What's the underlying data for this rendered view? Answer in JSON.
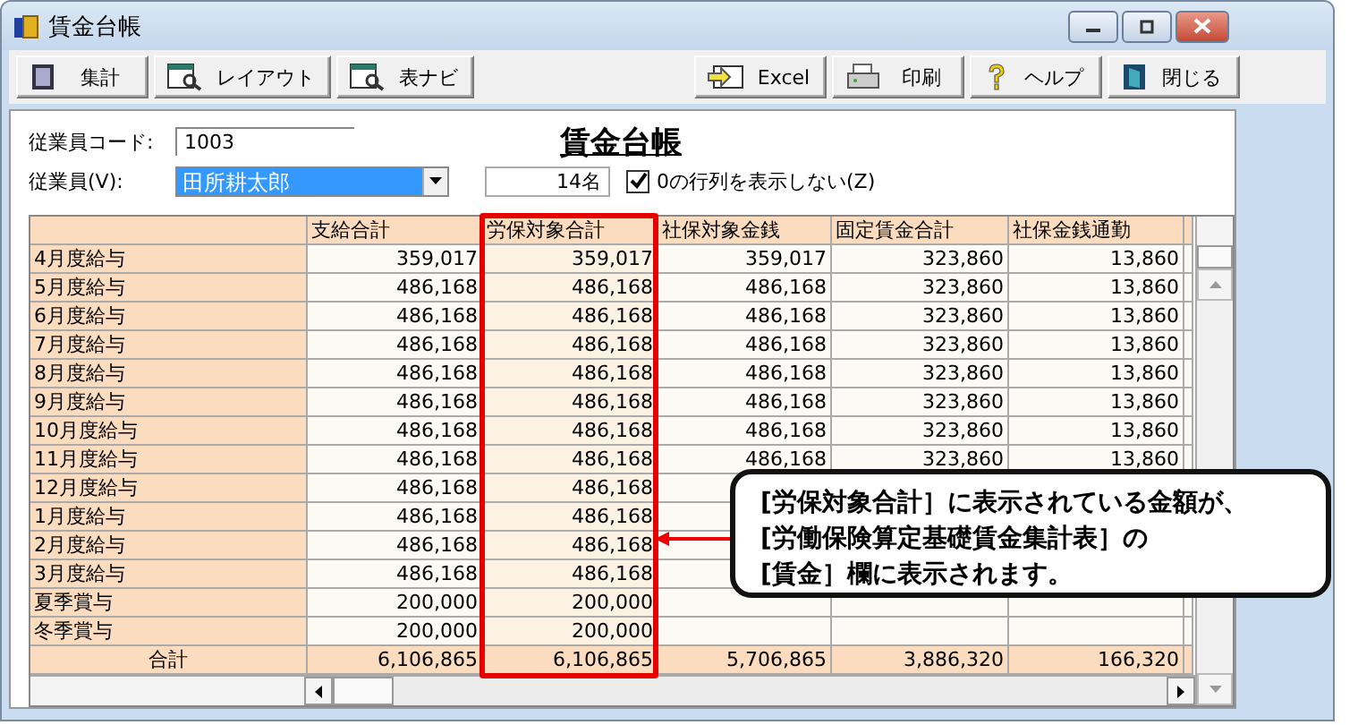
{
  "window": {
    "title": "賃金台帳"
  },
  "toolbar_left": [
    {
      "label": "集計"
    },
    {
      "label": "レイアウト"
    },
    {
      "label": "表ナビ"
    }
  ],
  "toolbar_right": [
    {
      "label": "Excel"
    },
    {
      "label": "印刷"
    },
    {
      "label": "ヘルプ"
    },
    {
      "label": "閉じる"
    }
  ],
  "form": {
    "code_label": "従業員コード:",
    "code_value": "1003",
    "report_title": "賃金台帳",
    "employee_label": "従業員(V):",
    "employee_value": "田所耕太郎",
    "count": "14名",
    "hide_zero": {
      "label": "0の行列を表示しない(Z)",
      "checked": true
    }
  },
  "table": {
    "columns": [
      "支給合計",
      "労保対象合計",
      "社保対象金銭",
      "固定賃金合計",
      "社保金銭通勤"
    ],
    "rows": [
      {
        "label": "4月度給与",
        "cells": [
          "359,017",
          "359,017",
          "359,017",
          "323,860",
          "13,860"
        ]
      },
      {
        "label": "5月度給与",
        "cells": [
          "486,168",
          "486,168",
          "486,168",
          "323,860",
          "13,860"
        ]
      },
      {
        "label": "6月度給与",
        "cells": [
          "486,168",
          "486,168",
          "486,168",
          "323,860",
          "13,860"
        ]
      },
      {
        "label": "7月度給与",
        "cells": [
          "486,168",
          "486,168",
          "486,168",
          "323,860",
          "13,860"
        ]
      },
      {
        "label": "8月度給与",
        "cells": [
          "486,168",
          "486,168",
          "486,168",
          "323,860",
          "13,860"
        ]
      },
      {
        "label": "9月度給与",
        "cells": [
          "486,168",
          "486,168",
          "486,168",
          "323,860",
          "13,860"
        ]
      },
      {
        "label": "10月度給与",
        "cells": [
          "486,168",
          "486,168",
          "486,168",
          "323,860",
          "13,860"
        ]
      },
      {
        "label": "11月度給与",
        "cells": [
          "486,168",
          "486,168",
          "486,168",
          "323,860",
          "13,860"
        ]
      },
      {
        "label": "12月度給与",
        "cells": [
          "486,168",
          "486,168",
          null,
          null,
          null
        ]
      },
      {
        "label": "1月度給与",
        "cells": [
          "486,168",
          "486,168",
          null,
          null,
          null
        ]
      },
      {
        "label": "2月度給与",
        "cells": [
          "486,168",
          "486,168",
          null,
          null,
          null
        ]
      },
      {
        "label": "3月度給与",
        "cells": [
          "486,168",
          "486,168",
          null,
          null,
          null
        ]
      },
      {
        "label": "夏季賞与",
        "cells": [
          "200,000",
          "200,000",
          null,
          null,
          null
        ]
      },
      {
        "label": "冬季賞与",
        "cells": [
          "200,000",
          "200,000",
          null,
          null,
          null
        ]
      }
    ],
    "total": {
      "label": "合計",
      "cells": [
        "6,106,865",
        "6,106,865",
        "5,706,865",
        "3,886,320",
        "166,320"
      ]
    }
  },
  "callout": {
    "lines": [
      "[労保対象合計］に表示されている金額が、",
      "[労働保険算定基礎賃金集計表］の",
      "[賃金］欄に表示されます。"
    ]
  }
}
